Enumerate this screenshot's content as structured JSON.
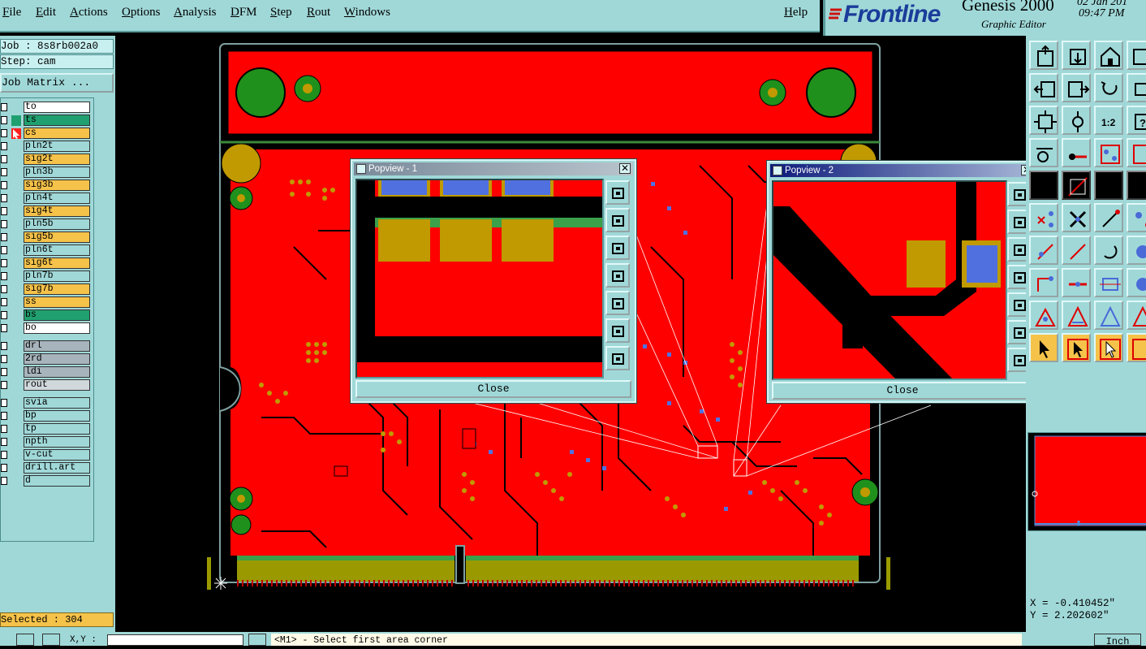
{
  "menu": [
    "File",
    "Edit",
    "Actions",
    "Options",
    "Analysis",
    "DFM",
    "Step",
    "Rout",
    "Windows"
  ],
  "help": "Help",
  "brand": {
    "logo": "Frontline",
    "product": "Genesis 2000",
    "subtitle": "Graphic Editor",
    "date": "02 Jan 201",
    "time": "09:47 PM"
  },
  "job": {
    "job_line": "Job : 8s8rb002a0",
    "step_line": "Step: cam",
    "matrix_button": "Job Matrix ..."
  },
  "layers": [
    {
      "name": "to",
      "color": "#ffffff"
    },
    {
      "name": "ts",
      "color": "#20a070",
      "mark": "#20a070"
    },
    {
      "name": "cs",
      "color": "#f5c24a",
      "mark": "#ff2020",
      "active": true
    },
    {
      "name": "pln2t",
      "color": "#a0d8d8"
    },
    {
      "name": "sig2t",
      "color": "#f5c24a"
    },
    {
      "name": "pln3b",
      "color": "#a0d8d8"
    },
    {
      "name": "sig3b",
      "color": "#f5c24a"
    },
    {
      "name": "pln4t",
      "color": "#a0d8d8"
    },
    {
      "name": "sig4t",
      "color": "#f5c24a"
    },
    {
      "name": "pln5b",
      "color": "#a0d8d8"
    },
    {
      "name": "sig5b",
      "color": "#f5c24a"
    },
    {
      "name": "pln6t",
      "color": "#a0d8d8"
    },
    {
      "name": "sig6t",
      "color": "#f5c24a"
    },
    {
      "name": "pln7b",
      "color": "#a0d8d8"
    },
    {
      "name": "sig7b",
      "color": "#f5c24a"
    },
    {
      "name": "ss",
      "color": "#f5c24a"
    },
    {
      "name": "bs",
      "color": "#20a070"
    },
    {
      "name": "bo",
      "color": "#ffffff"
    },
    {
      "name": "drl",
      "color": "#a8b4bc"
    },
    {
      "name": "2rd",
      "color": "#a8b4bc"
    },
    {
      "name": "ldi",
      "color": "#a8b4bc"
    },
    {
      "name": "rout",
      "color": "#d0d8dc"
    },
    {
      "name": "svia",
      "color": "#a0d8d8"
    },
    {
      "name": "bp",
      "color": "#a0d8d8"
    },
    {
      "name": "tp",
      "color": "#a0d8d8"
    },
    {
      "name": "npth",
      "color": "#a0d8d8"
    },
    {
      "name": "v-cut",
      "color": "#a0d8d8"
    },
    {
      "name": "drill.art",
      "color": "#a0d8d8"
    },
    {
      "name": "d",
      "color": "#a0d8d8"
    }
  ],
  "selected": "Selected : 304",
  "popview1": {
    "title": "Popview - 1",
    "close": "Close"
  },
  "popview2": {
    "title": "Popview - 2",
    "close": "Close"
  },
  "coords": {
    "x": "X = -0.410452\"",
    "y": "Y = 2.202602\""
  },
  "status": {
    "xy_label": "X,Y :",
    "prompt": "<M1> - Select first area corner",
    "units": "Inch"
  },
  "colors": {
    "panel": "#a0d8d8",
    "copper": "#ff0000",
    "pad": "#c09a00",
    "via": "#5070e0",
    "mask": "#20a070"
  },
  "icons": {
    "toolbar": [
      "snap-icon",
      "zoom-icon",
      "home-icon",
      "save-icon",
      "pan-left-icon",
      "pan-right-icon",
      "undo-icon",
      "fit-icon",
      "zoom-fit-icon",
      "scale-icon",
      "help-icon",
      "route-icon",
      "net-icon",
      "connect-icon",
      "measure-icon",
      "cross-icon",
      "ruler-icon",
      "pin-icon",
      "line-icon",
      "arc-icon",
      "select-icon"
    ]
  }
}
